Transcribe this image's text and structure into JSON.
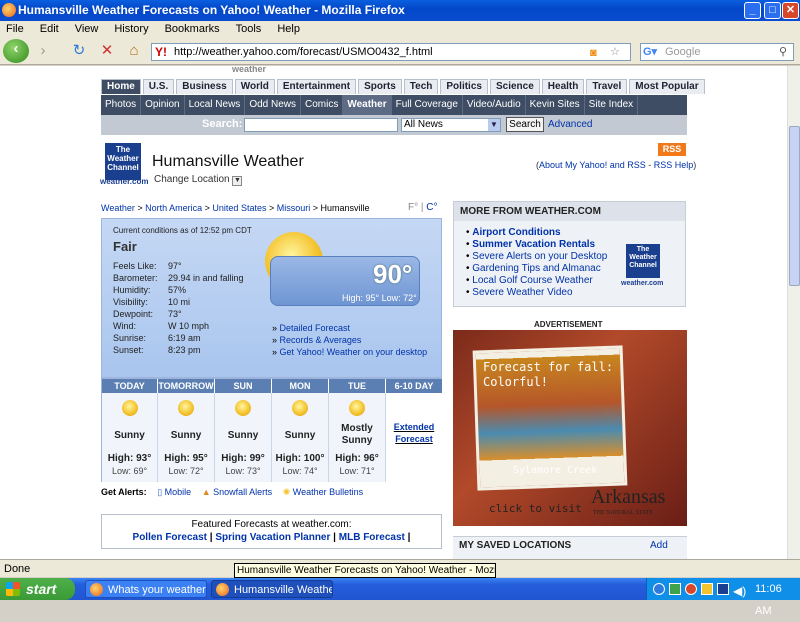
{
  "window": {
    "title": "Humansville Weather Forecasts on Yahoo! Weather - Mozilla Firefox"
  },
  "menu": [
    "File",
    "Edit",
    "View",
    "History",
    "Bookmarks",
    "Tools",
    "Help"
  ],
  "nav": {
    "url": "http://weather.yahoo.com/forecast/USMO0432_f.html",
    "search_placeholder": "Google"
  },
  "yahoo": {
    "tabs": [
      "Home",
      "U.S.",
      "Business",
      "World",
      "Entertainment",
      "Sports",
      "Tech",
      "Politics",
      "Science",
      "Health",
      "Travel",
      "Most Popular"
    ],
    "subtabs": [
      "Photos",
      "Opinion",
      "Local News",
      "Odd News",
      "Comics",
      "Weather",
      "Full Coverage",
      "Video/Audio",
      "Kevin Sites",
      "Site Index"
    ],
    "search_label": "Search:",
    "search_scope": "All News",
    "search_button": "Search",
    "advanced": "Advanced"
  },
  "header": {
    "logo_line1": "The",
    "logo_line2": "Weather",
    "logo_line3": "Channel",
    "logo_site": "weather.com",
    "title": "Humansville Weather",
    "change_location": "Change Location",
    "rss": "RSS",
    "about": "About My Yahoo! and RSS",
    "rss_help": "RSS Help"
  },
  "breadcrumb": {
    "weather": "Weather",
    "na": "North America",
    "us": "United States",
    "mo": "Missouri",
    "city": "Humansville",
    "units_f": "F°",
    "units_c": "C°"
  },
  "current": {
    "as_of": "Current conditions as of 12:52 pm CDT",
    "condition": "Fair",
    "temp": "90°",
    "hi_lo": "High: 95° Low: 72°",
    "rows": [
      {
        "label": "Feels Like:",
        "value": "97°"
      },
      {
        "label": "Barometer:",
        "value": "29.94 in and falling"
      },
      {
        "label": "Humidity:",
        "value": "57%"
      },
      {
        "label": "Visibility:",
        "value": "10 mi"
      },
      {
        "label": "Dewpoint:",
        "value": "73°"
      },
      {
        "label": "Wind:",
        "value": "W 10 mph"
      },
      {
        "label": "Sunrise:",
        "value": "6:19 am"
      },
      {
        "label": "Sunset:",
        "value": "8:23 pm"
      }
    ],
    "links": [
      "Detailed Forecast",
      "Records & Averages",
      "Get Yahoo! Weather on your desktop"
    ]
  },
  "forecast": [
    {
      "day": "TODAY",
      "cond": "Sunny",
      "cond2": "",
      "hi": "High: 93°",
      "lo": "Low: 69°"
    },
    {
      "day": "TOMORROW",
      "cond": "Sunny",
      "cond2": "",
      "hi": "High: 95°",
      "lo": "Low: 72°"
    },
    {
      "day": "SUN",
      "cond": "Sunny",
      "cond2": "",
      "hi": "High: 99°",
      "lo": "Low: 73°"
    },
    {
      "day": "MON",
      "cond": "Sunny",
      "cond2": "",
      "hi": "High: 100°",
      "lo": "Low: 74°"
    },
    {
      "day": "TUE",
      "cond": "Mostly",
      "cond2": "Sunny",
      "hi": "High: 96°",
      "lo": "Low: 71°"
    }
  ],
  "sixday": {
    "head": "6-10 DAY",
    "link1": "Extended",
    "link2": "Forecast"
  },
  "alerts": {
    "label": "Get Alerts:",
    "mobile": "Mobile",
    "snowfall": "Snowfall Alerts",
    "bulletins": "Weather Bulletins"
  },
  "featured": {
    "title": "Featured Forecasts at weather.com:",
    "links": [
      "Pollen Forecast",
      "Spring Vacation Planner",
      "MLB Forecast"
    ]
  },
  "more": {
    "title": "MORE FROM WEATHER.COM",
    "items": [
      "Airport Conditions",
      "Summer Vacation Rentals",
      "Severe Alerts on your Desktop",
      "Gardening Tips and Almanac",
      "Local Golf Course Weather",
      "Severe Weather Video"
    ]
  },
  "ad": {
    "label": "ADVERTISEMENT",
    "headline1": "Forecast for fall:",
    "headline2": "Colorful!",
    "caption": "Sylamore Creek",
    "cta": "click to visit",
    "brand": "Arkansas",
    "brand_sub": "THE NATURAL STATE"
  },
  "saved": {
    "title": "MY SAVED LOCATIONS",
    "add": "Add"
  },
  "status": {
    "text": "Done",
    "tooltip": "Humansville Weather Forecasts on Yahoo! Weather - Mozilla Firefox"
  },
  "taskbar": {
    "start": "start",
    "tasks": [
      "Whats your weather l...",
      "Humansville Weather ..."
    ],
    "clock": "11:06 AM"
  }
}
